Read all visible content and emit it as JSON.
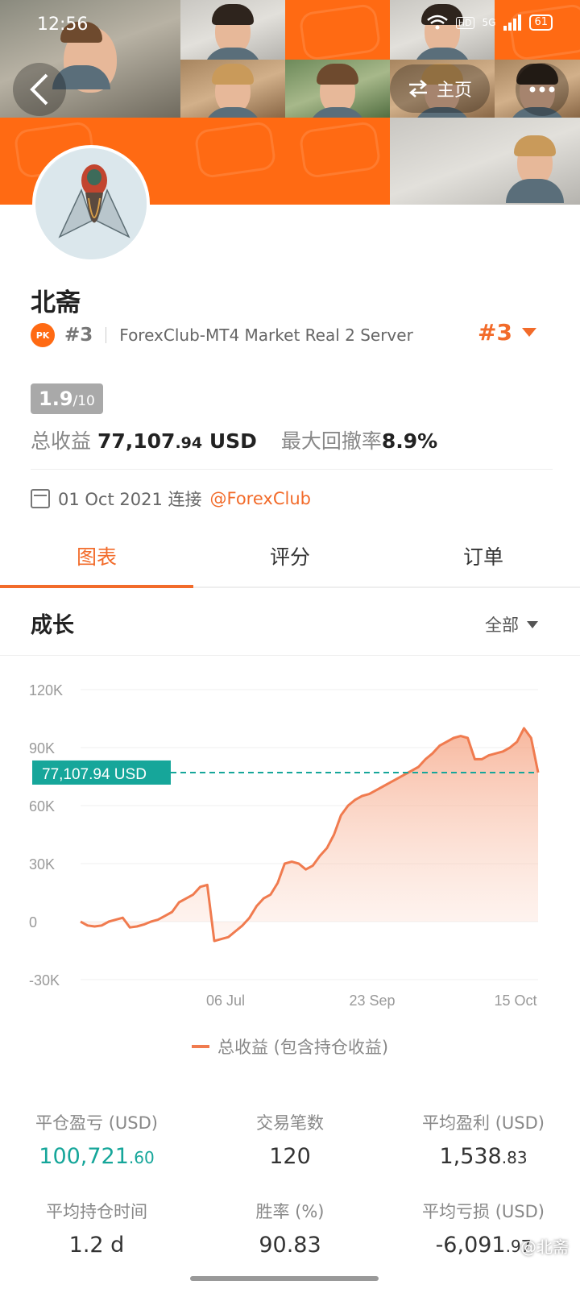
{
  "status_bar": {
    "time": "12:56",
    "net": "5G",
    "hd": "HD",
    "battery": "61"
  },
  "header": {
    "home_label": "主页"
  },
  "profile": {
    "name": "北斋",
    "pk_badge": "PK",
    "rank_small": "#3",
    "server": "ForexClub-MT4 Market Real 2 Server",
    "rank_big": "#3",
    "score": "1.9",
    "score_max": "/10",
    "total_profit_label": "总收益",
    "total_profit_main": "77,107",
    "total_profit_dec": ".94",
    "total_profit_unit": "USD",
    "drawdown_label": "最大回撤率",
    "drawdown_value": "8.9%",
    "connect_date": "01 Oct 2021 连接",
    "connect_broker": "@ForexClub"
  },
  "tabs": [
    {
      "label": "图表",
      "active": true
    },
    {
      "label": "评分",
      "active": false
    },
    {
      "label": "订单",
      "active": false
    }
  ],
  "growth": {
    "title": "成长",
    "range": "全部"
  },
  "chart_data": {
    "type": "area",
    "ylim": [
      -30000,
      120000
    ],
    "yticks": [
      "120K",
      "90K",
      "60K",
      "30K",
      "0",
      "-30K"
    ],
    "ytick_values": [
      120000,
      90000,
      60000,
      30000,
      0,
      -30000
    ],
    "xticks": [
      "06 Jul",
      "23 Sep",
      "15 Oct"
    ],
    "current_value_label": "77,107.94 USD",
    "current_value": 77107.94,
    "series": [
      {
        "name": "总收益 (包含持仓收益)",
        "color": "#f07b4f",
        "values": [
          0,
          -2000,
          -2500,
          -2000,
          0,
          1000,
          2000,
          -3000,
          -2500,
          -1500,
          0,
          1000,
          3000,
          5000,
          10000,
          12000,
          14000,
          18000,
          19000,
          -10000,
          -9000,
          -8000,
          -5000,
          -2000,
          2000,
          8000,
          12000,
          14000,
          20000,
          30000,
          31000,
          30000,
          27000,
          29000,
          34000,
          38000,
          45000,
          55000,
          60000,
          63000,
          65000,
          66000,
          68000,
          70000,
          72000,
          74000,
          76000,
          78000,
          80000,
          84000,
          87000,
          91000,
          93000,
          95000,
          96000,
          95000,
          84000,
          84000,
          86000,
          87000,
          88000,
          90000,
          93000,
          100000,
          95000,
          77107.94
        ]
      }
    ]
  },
  "summary": [
    {
      "label": "平仓盈亏 (USD)",
      "main": "100,721",
      "dec": ".60",
      "green": true
    },
    {
      "label": "交易笔数",
      "main": "120",
      "dec": "",
      "green": false
    },
    {
      "label": "平均盈利 (USD)",
      "main": "1,538",
      "dec": ".83",
      "green": false
    },
    {
      "label": "平均持仓时间",
      "main": "1.2 d",
      "dec": "",
      "green": false
    },
    {
      "label": "胜率 (%)",
      "main": "90.83",
      "dec": "",
      "green": false
    },
    {
      "label": "平均亏损 (USD)",
      "main": "-6,091",
      "dec": ".97",
      "green": false
    }
  ],
  "watermark": "@北斋",
  "colors": {
    "accent": "#f26b2a",
    "green": "#16a69a",
    "header_orange": "#ff6a13"
  }
}
